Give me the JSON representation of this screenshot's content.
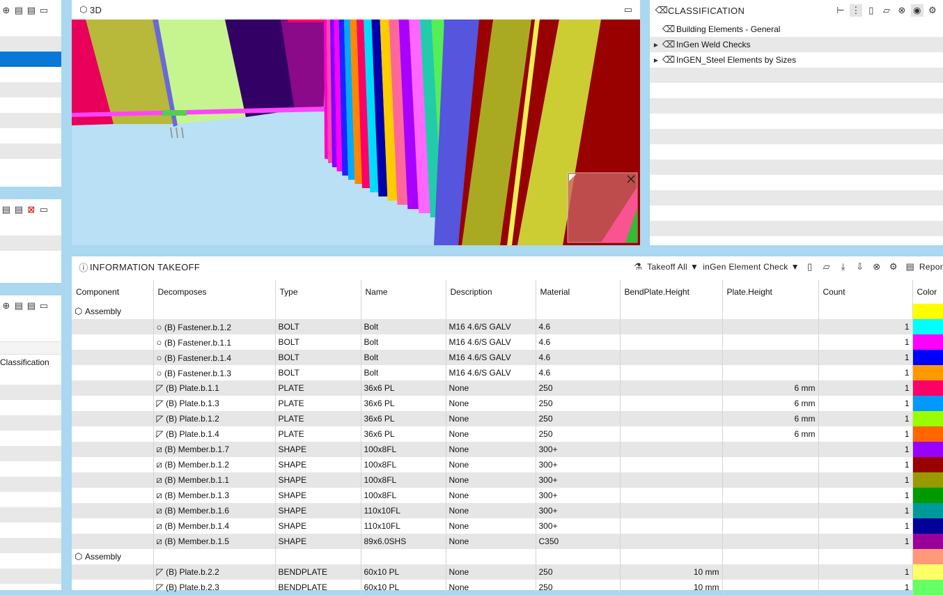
{
  "viewer": {
    "title": "3D"
  },
  "classification": {
    "title": "CLASSIFICATION",
    "items": [
      {
        "label": "Building Elements - General",
        "expandable": false
      },
      {
        "label": "InGen Weld Checks",
        "expandable": true
      },
      {
        "label": "InGEN_Steel Elements by Sizes",
        "expandable": true
      }
    ]
  },
  "left_panel": {
    "column_label": "Classification"
  },
  "takeoff": {
    "title": "INFORMATION TAKEOFF",
    "takeoff_all": "Takeoff All",
    "element_check": "inGen Element Check",
    "report": "Repor",
    "columns": [
      "Component",
      "Decomposes",
      "Type",
      "Name",
      "Description",
      "Material",
      "BendPlate.Height",
      "Plate.Height",
      "Count",
      "Color"
    ],
    "rows": [
      {
        "component": "Assembly",
        "decomposes": "",
        "type": "",
        "name": "",
        "description": "",
        "material": "",
        "bend": "",
        "plate": "",
        "count": "",
        "color": "#ffff00",
        "icon": "assembly"
      },
      {
        "component": "",
        "decomposes": "(B) Fastener.b.1.2",
        "type": "BOLT",
        "name": "Bolt",
        "description": "M16 4.6/S GALV",
        "material": "4.6",
        "bend": "",
        "plate": "",
        "count": "1",
        "color": "#00ffff",
        "icon": "bolt"
      },
      {
        "component": "",
        "decomposes": "(B) Fastener.b.1.1",
        "type": "BOLT",
        "name": "Bolt",
        "description": "M16 4.6/S GALV",
        "material": "4.6",
        "bend": "",
        "plate": "",
        "count": "1",
        "color": "#ff00ff",
        "icon": "bolt"
      },
      {
        "component": "",
        "decomposes": "(B) Fastener.b.1.4",
        "type": "BOLT",
        "name": "Bolt",
        "description": "M16 4.6/S GALV",
        "material": "4.6",
        "bend": "",
        "plate": "",
        "count": "1",
        "color": "#0000ff",
        "icon": "bolt"
      },
      {
        "component": "",
        "decomposes": "(B) Fastener.b.1.3",
        "type": "BOLT",
        "name": "Bolt",
        "description": "M16 4.6/S GALV",
        "material": "4.6",
        "bend": "",
        "plate": "",
        "count": "1",
        "color": "#ff9900",
        "icon": "bolt"
      },
      {
        "component": "",
        "decomposes": "(B) Plate.b.1.1",
        "type": "PLATE",
        "name": "36x6 PL",
        "description": "None",
        "material": "250",
        "bend": "",
        "plate": "6 mm",
        "count": "1",
        "color": "#ff0066",
        "icon": "plate"
      },
      {
        "component": "",
        "decomposes": "(B) Plate.b.1.3",
        "type": "PLATE",
        "name": "36x6 PL",
        "description": "None",
        "material": "250",
        "bend": "",
        "plate": "6 mm",
        "count": "1",
        "color": "#0099ff",
        "icon": "plate"
      },
      {
        "component": "",
        "decomposes": "(B) Plate.b.1.2",
        "type": "PLATE",
        "name": "36x6 PL",
        "description": "None",
        "material": "250",
        "bend": "",
        "plate": "6 mm",
        "count": "1",
        "color": "#99ff00",
        "icon": "plate"
      },
      {
        "component": "",
        "decomposes": "(B) Plate.b.1.4",
        "type": "PLATE",
        "name": "36x6 PL",
        "description": "None",
        "material": "250",
        "bend": "",
        "plate": "6 mm",
        "count": "1",
        "color": "#ff6600",
        "icon": "plate"
      },
      {
        "component": "",
        "decomposes": "(B) Member.b.1.7",
        "type": "SHAPE",
        "name": "100x8FL",
        "description": "None",
        "material": "300+",
        "bend": "",
        "plate": "",
        "count": "1",
        "color": "#9900ff",
        "icon": "member"
      },
      {
        "component": "",
        "decomposes": "(B) Member.b.1.2",
        "type": "SHAPE",
        "name": "100x8FL",
        "description": "None",
        "material": "300+",
        "bend": "",
        "plate": "",
        "count": "1",
        "color": "#990000",
        "icon": "member"
      },
      {
        "component": "",
        "decomposes": "(B) Member.b.1.1",
        "type": "SHAPE",
        "name": "100x8FL",
        "description": "None",
        "material": "300+",
        "bend": "",
        "plate": "",
        "count": "1",
        "color": "#999900",
        "icon": "member"
      },
      {
        "component": "",
        "decomposes": "(B) Member.b.1.3",
        "type": "SHAPE",
        "name": "100x8FL",
        "description": "None",
        "material": "300+",
        "bend": "",
        "plate": "",
        "count": "1",
        "color": "#009900",
        "icon": "member"
      },
      {
        "component": "",
        "decomposes": "(B) Member.b.1.6",
        "type": "SHAPE",
        "name": "110x10FL",
        "description": "None",
        "material": "300+",
        "bend": "",
        "plate": "",
        "count": "1",
        "color": "#009999",
        "icon": "member"
      },
      {
        "component": "",
        "decomposes": "(B) Member.b.1.4",
        "type": "SHAPE",
        "name": "110x10FL",
        "description": "None",
        "material": "300+",
        "bend": "",
        "plate": "",
        "count": "1",
        "color": "#000099",
        "icon": "member"
      },
      {
        "component": "",
        "decomposes": "(B) Member.b.1.5",
        "type": "SHAPE",
        "name": "89x6.0SHS",
        "description": "None",
        "material": "C350",
        "bend": "",
        "plate": "",
        "count": "1",
        "color": "#990099",
        "icon": "member"
      },
      {
        "component": "Assembly",
        "decomposes": "",
        "type": "",
        "name": "",
        "description": "",
        "material": "",
        "bend": "",
        "plate": "",
        "count": "",
        "color": "#ff9977",
        "icon": "assembly"
      },
      {
        "component": "",
        "decomposes": "(B) Plate.b.2.2",
        "type": "BENDPLATE",
        "name": "60x10 PL",
        "description": "None",
        "material": "250",
        "bend": "10 mm",
        "plate": "",
        "count": "1",
        "color": "#ffff66",
        "icon": "plate"
      },
      {
        "component": "",
        "decomposes": "(B) Plate.b.2.3",
        "type": "BENDPLATE",
        "name": "60x10 PL",
        "description": "None",
        "material": "250",
        "bend": "10 mm",
        "plate": "",
        "count": "1",
        "color": "#66ff66",
        "icon": "plate"
      }
    ]
  }
}
